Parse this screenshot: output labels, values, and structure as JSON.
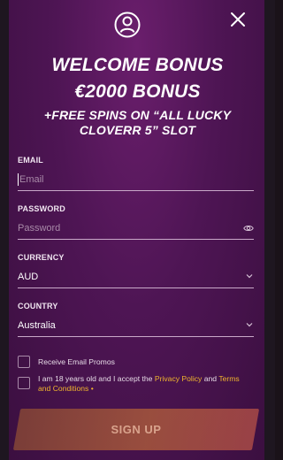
{
  "modal": {
    "headline_1": "WELCOME BONUS",
    "headline_2": "€2000 BONUS",
    "headline_3": "+FREE SPINS ON “ALL LUCKY",
    "headline_4": "CLOVERR 5” SLOT"
  },
  "form": {
    "email": {
      "label": "EMAIL",
      "placeholder": "Email"
    },
    "password": {
      "label": "PASSWORD",
      "placeholder": "Password"
    },
    "currency": {
      "label": "CURRENCY",
      "value": "AUD"
    },
    "country": {
      "label": "COUNTRY",
      "value": "Australia"
    },
    "promos_label": "Receive Email Promos",
    "terms_prefix": "I am 18 years old and I accept the",
    "privacy_link": "Privacy Policy",
    "terms_and": "and",
    "terms_link_1": "Terms",
    "terms_link_2": "and Conditions",
    "required_mark": "•",
    "submit_label": "SIGN UP"
  },
  "colors": {
    "modal_bg": "#4e1554",
    "link": "#f0b52e",
    "button_start": "#8b4a35",
    "button_end": "#b34f47"
  },
  "icons": [
    "user-icon",
    "close-icon",
    "eye-icon",
    "chevron-down-icon"
  ]
}
